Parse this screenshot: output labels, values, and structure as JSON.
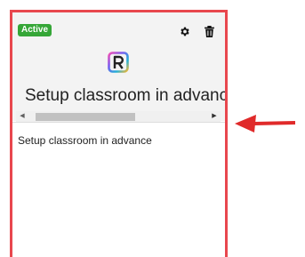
{
  "card": {
    "status_badge": "Active",
    "title": "Setup classroom in advance",
    "description": "Setup classroom in advance"
  },
  "icons": {
    "settings": "gear-icon",
    "delete": "trash-icon",
    "app_logo": "app-logo-icon",
    "scroll_left": "scroll-left-arrow",
    "scroll_right": "scroll-right-arrow",
    "annotation": "red-pointer-arrow"
  },
  "colors": {
    "card_border": "#e8474e",
    "badge_bg": "#35a637",
    "annotation_arrow": "#e02a2a"
  }
}
